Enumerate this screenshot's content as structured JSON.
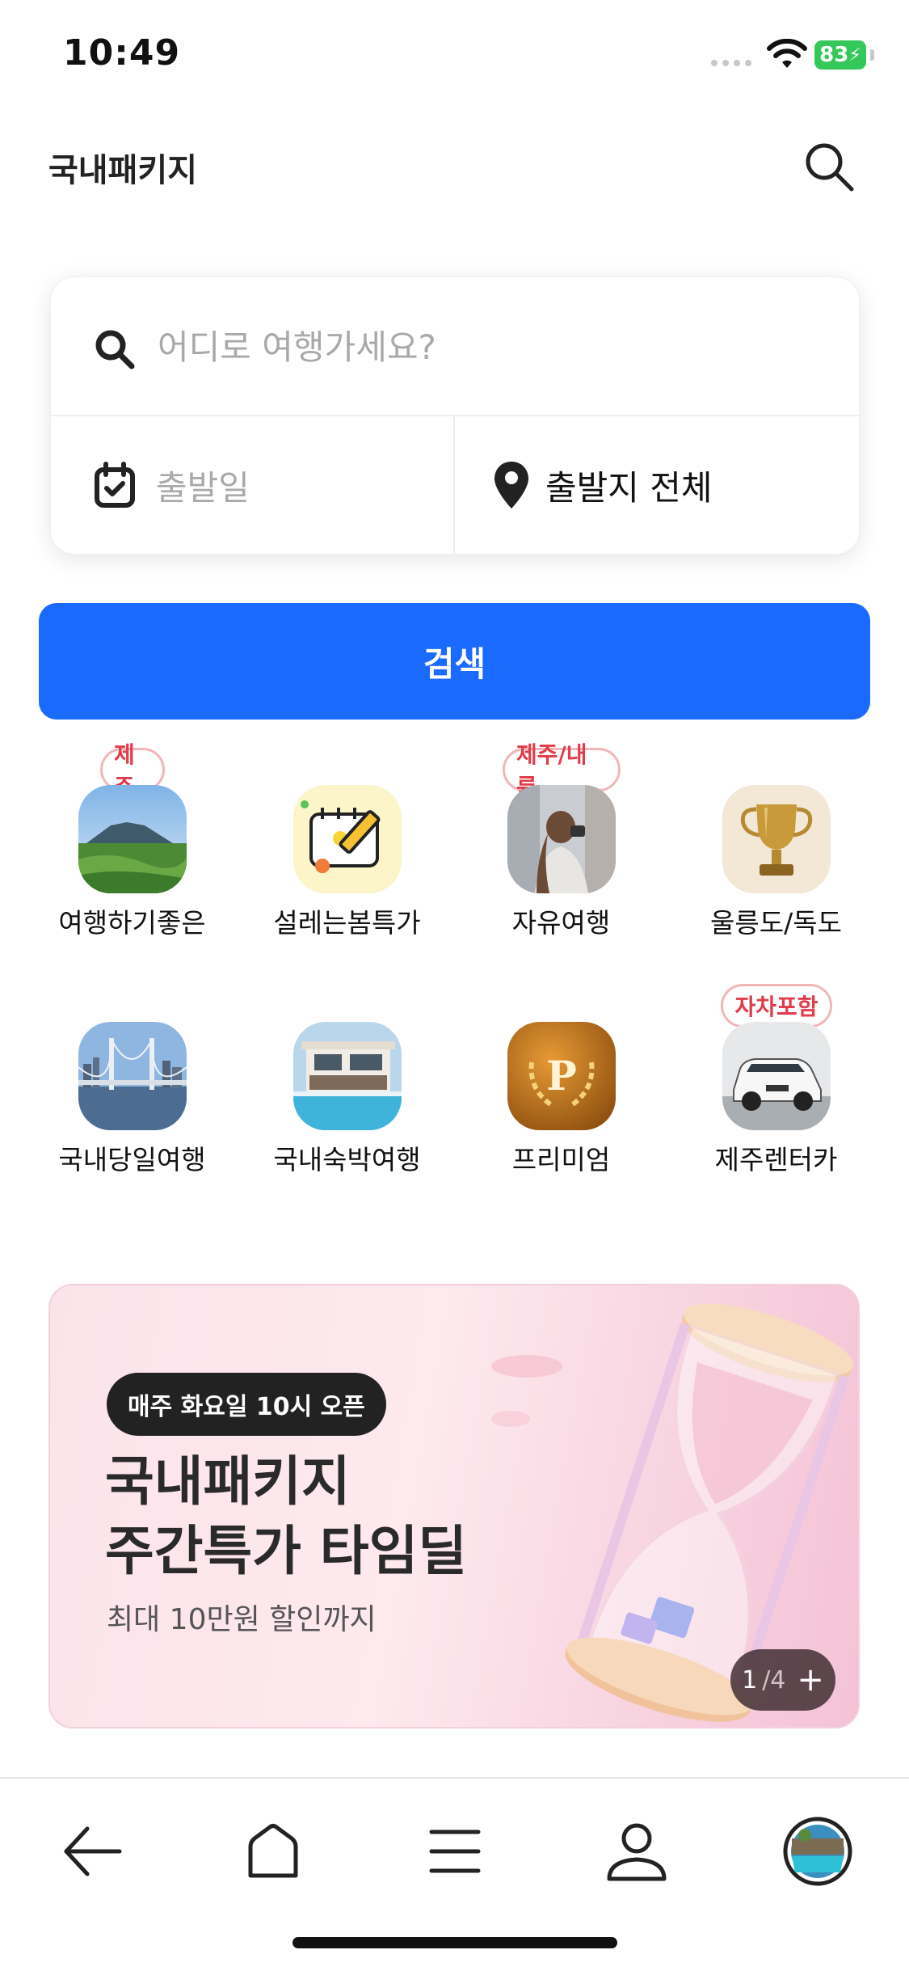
{
  "status_bar": {
    "time": "10:49",
    "battery": "83"
  },
  "header": {
    "title": "국내패키지"
  },
  "search_card": {
    "destination_placeholder": "어디로 여행가세요?",
    "date_placeholder": "출발일",
    "origin_value": "출발지 전체"
  },
  "search_button": {
    "label": "검색"
  },
  "categories": [
    {
      "label": "여행하기좋은",
      "badge": "제주",
      "icon": "jeju-landscape-icon"
    },
    {
      "label": "설레는봄특가",
      "badge": "",
      "icon": "calendar-pencil-icon"
    },
    {
      "label": "자유여행",
      "badge": "제주/내륙",
      "icon": "traveler-camera-icon"
    },
    {
      "label": "울릉도/독도",
      "badge": "",
      "icon": "trophy-icon"
    },
    {
      "label": "국내당일여행",
      "badge": "",
      "icon": "bridge-city-icon"
    },
    {
      "label": "국내숙박여행",
      "badge": "",
      "icon": "pool-villa-icon"
    },
    {
      "label": "프리미엄",
      "badge": "",
      "icon": "premium-p-icon"
    },
    {
      "label": "제주렌터카",
      "badge": "자차포함",
      "icon": "rental-car-icon"
    }
  ],
  "banner": {
    "chip": "매주 화요일 10시 오픈",
    "title_line1": "국내패키지",
    "title_line2": "주간특가 타임딜",
    "subtitle": "최대 10만원 할인까지",
    "pager_current": "1",
    "pager_total": "/4",
    "pager_plus": "+"
  },
  "bottom_nav": [
    "back-icon",
    "home-icon",
    "menu-icon",
    "person-icon",
    "profile-avatar"
  ],
  "colors": {
    "primary": "#1a6aff",
    "badge_red": "#e03c49",
    "battery_green": "#34c759"
  }
}
